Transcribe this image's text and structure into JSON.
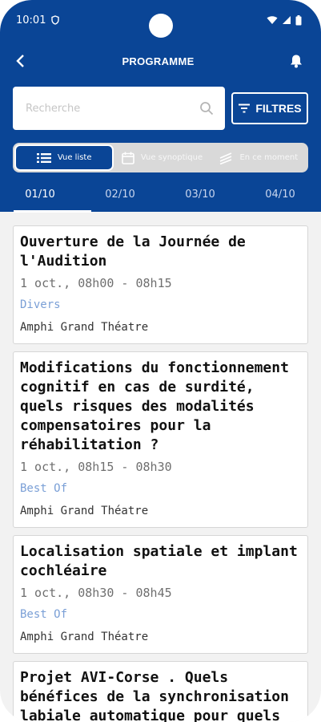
{
  "status": {
    "time": "10:01"
  },
  "topbar": {
    "title": "PROGRAMME"
  },
  "search": {
    "placeholder": "Recherche"
  },
  "filters_label": "FILTRES",
  "views": [
    {
      "label": "Vue liste",
      "active": true,
      "icon": "list-icon"
    },
    {
      "label": "Vue synoptique",
      "active": false,
      "icon": "calendar-icon"
    },
    {
      "label": "En ce moment",
      "active": false,
      "icon": "broadcast-icon"
    }
  ],
  "tabs": [
    "01/10",
    "02/10",
    "03/10",
    "04/10"
  ],
  "sessions": [
    {
      "title": "Ouverture de la Journée de l'Audition",
      "time": "1 oct., 08h00 - 08h15",
      "category": "Divers",
      "room": "Amphi Grand Théatre"
    },
    {
      "title": "Modifications du fonctionnement cognitif en cas de surdité, quels risques des modalités compensatoires pour la réhabilitation ?",
      "time": "1 oct., 08h15 - 08h30",
      "category": "Best Of",
      "room": "Amphi Grand Théatre"
    },
    {
      "title": "Localisation spatiale et implant cochléaire",
      "time": "1 oct., 08h30 - 08h45",
      "category": "Best Of",
      "room": "Amphi Grand Théatre"
    },
    {
      "title": "Projet AVI-Corse . Quels bénéfices de la synchronisation labiale automatique pour quels publics en orthophonie ?",
      "time": "",
      "category": "",
      "room": ""
    }
  ]
}
